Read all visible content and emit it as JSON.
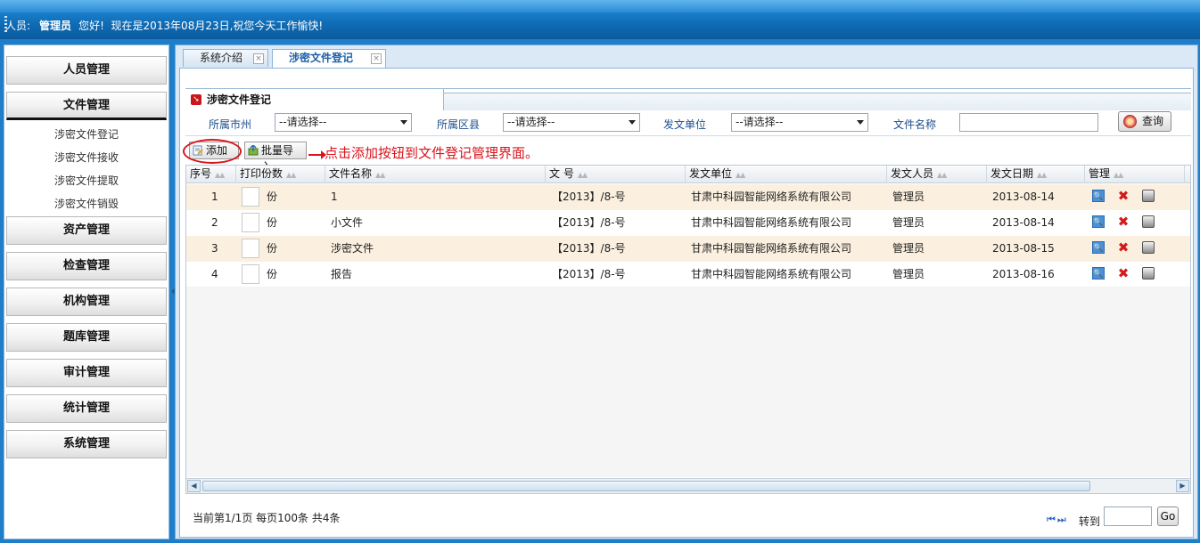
{
  "header": {
    "user_label": "人员:",
    "user_name": "管理员",
    "greeting": "您好!",
    "message": "现在是2013年08月23日,祝您今天工作愉快!"
  },
  "sidebar": {
    "menus": [
      {
        "label": "人员管理"
      },
      {
        "label": "文件管理"
      },
      {
        "label": "资产管理"
      },
      {
        "label": "检查管理"
      },
      {
        "label": "机构管理"
      },
      {
        "label": "题库管理"
      },
      {
        "label": "审计管理"
      },
      {
        "label": "统计管理"
      },
      {
        "label": "系统管理"
      }
    ],
    "file_submenu": [
      {
        "label": "涉密文件登记"
      },
      {
        "label": "涉密文件接收"
      },
      {
        "label": "涉密文件提取"
      },
      {
        "label": "涉密文件销毁"
      }
    ],
    "collapse_glyph": "«"
  },
  "tabs": [
    {
      "label": "系统介绍",
      "close": "×"
    },
    {
      "label": "涉密文件登记",
      "close": "×"
    }
  ],
  "section": {
    "title": "涉密文件登记"
  },
  "filters": {
    "city_label": "所属市州",
    "city_value": "--请选择--",
    "district_label": "所属区县",
    "district_value": "--请选择--",
    "issuer_label": "发文单位",
    "issuer_value": "--请选择--",
    "filename_label": "文件名称",
    "filename_value": "",
    "query_label": "查询"
  },
  "toolbar": {
    "add_label": "添加",
    "import_label": "批量导入",
    "annotation": "点击添加按钮到文件登记管理界面。"
  },
  "table": {
    "columns": [
      "序号",
      "打印份数",
      "文件名称",
      "文 号",
      "发文单位",
      "发文人员",
      "发文日期",
      "管理"
    ],
    "copies_unit": "份",
    "rows": [
      {
        "no": "1",
        "name": "1",
        "doc_no": "【2013】/8-号",
        "unit": "甘肃中科园智能网络系统有限公司",
        "person": "管理员",
        "date": "2013-08-14"
      },
      {
        "no": "2",
        "name": "小文件",
        "doc_no": "【2013】/8-号",
        "unit": "甘肃中科园智能网络系统有限公司",
        "person": "管理员",
        "date": "2013-08-14"
      },
      {
        "no": "3",
        "name": "涉密文件",
        "doc_no": "【2013】/8-号",
        "unit": "甘肃中科园智能网络系统有限公司",
        "person": "管理员",
        "date": "2013-08-15"
      },
      {
        "no": "4",
        "name": "报告",
        "doc_no": "【2013】/8-号",
        "unit": "甘肃中科园智能网络系统有限公司",
        "person": "管理员",
        "date": "2013-08-16"
      }
    ]
  },
  "pagination": {
    "info": "当前第1/1页 每页100条 共4条",
    "nav": "⏮⏭",
    "goto_label": "转到",
    "go_label": "Go"
  }
}
